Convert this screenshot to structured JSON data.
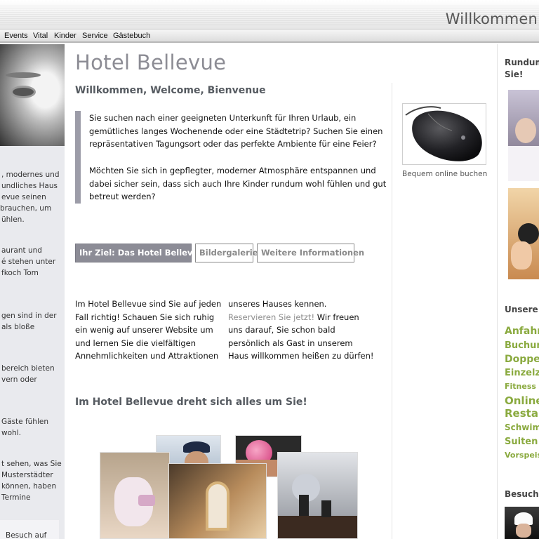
{
  "header": {
    "title": "Willkommen"
  },
  "nav": {
    "items": [
      "Events",
      "Vital",
      "Kinder",
      "Service",
      "Gästebuch"
    ]
  },
  "left_sidebar": {
    "lines": [
      ", modernes und",
      "undliches Haus",
      "evue seinen",
      " brauchen, um",
      "ühlen.",
      "aurant und",
      "é stehen unter",
      "fkoch Tom",
      "gen sind in der",
      "als bloße",
      "bereich bieten",
      "vern oder",
      "Gäste fühlen",
      "wohl.",
      "t sehen, was Sie",
      "Musterstädter",
      "können, haben",
      "Termine",
      "Besuch auf"
    ]
  },
  "main": {
    "title": "Hotel Bellevue",
    "welcome": "Willkommen, Welcome, Bienvenue",
    "intro": [
      "Sie suchen nach einer geeigneten Unterkunft für Ihren Urlaub, ein gemütliches langes Wochenende oder eine Städtetrip? Suchen Sie einen repräsentativen Tagungsort oder das perfekte Ambiente für eine Feier?",
      "Möchten Sie sich in gepflegter, moderner Atmosphäre entspannen und dabei sicher sein, dass sich auch Ihre Kinder rundum wohl fühlen und gut betreut werden?"
    ],
    "tabs": [
      "Ihr Ziel: Das Hotel Bellevue",
      "Bildergalerie",
      "Weitere Informationen"
    ],
    "col1": "Im Hotel Bellevue sind Sie auf jeden Fall richtig! Schauen Sie sich ruhig ein wenig auf unserer Website um und lernen Sie die vielfältigen Annehmlichkeiten und Attraktionen",
    "col2_before": "unseres Hauses kennen. ",
    "col2_link": "Reservieren Sie jetzt!",
    "col2_after": " Wir freuen uns darauf, Sie schon bald persönlich als Gast in unserem Haus willkommen heißen zu dürfen!",
    "section_heading": "Im Hotel Bellevue dreht sich alles um Sie!"
  },
  "booking": {
    "caption": "Bequem online buchen",
    "image": "computer-mouse"
  },
  "right_sidebar": {
    "heading_lines": [
      "Rundum",
      "Sie!"
    ],
    "offers_heading": "Unsere I",
    "links": [
      "Anfahrt",
      "Buchung",
      "Doppel",
      "Einzelzi",
      "Fitness G",
      "Online-",
      "Restau",
      "Schwimm",
      "Suiten T",
      "Vorspeise"
    ],
    "visit_heading": "Besuche"
  },
  "colors": {
    "accent_gray": "#8c8c96",
    "link_green": "#8aaa3f"
  }
}
